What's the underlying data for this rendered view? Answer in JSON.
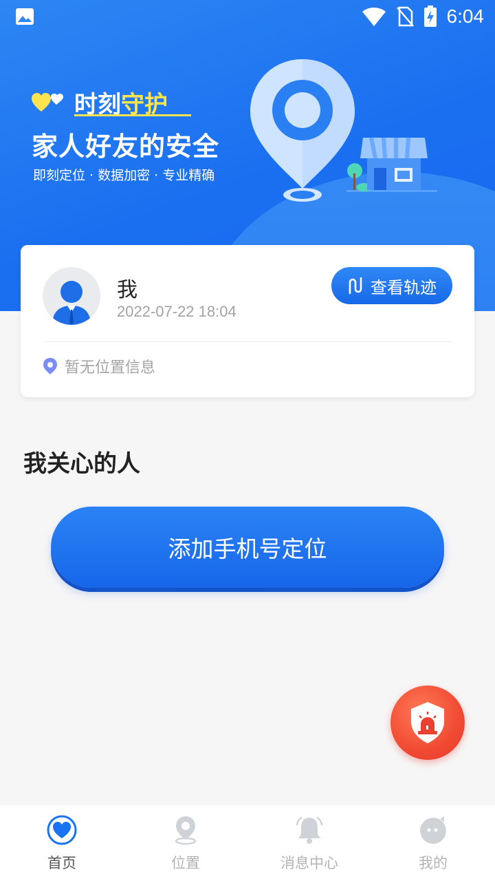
{
  "status_bar": {
    "time": "6:04"
  },
  "hero": {
    "title_part1": "时刻",
    "title_part2": "守护",
    "subtitle": "家人好友的安全",
    "features": "即刻定位 · 数据加密 · 专业精确"
  },
  "my_card": {
    "name": "我",
    "timestamp": "2022-07-22 18:04",
    "track_button": "查看轨迹",
    "location_text": "暂无位置信息"
  },
  "section": {
    "title": "我关心的人"
  },
  "add_button": {
    "label": "添加手机号定位"
  },
  "tabs": [
    {
      "label": "首页",
      "icon": "home-heart-icon",
      "active": true
    },
    {
      "label": "位置",
      "icon": "location-pin-icon",
      "active": false
    },
    {
      "label": "消息中心",
      "icon": "bell-icon",
      "active": false
    },
    {
      "label": "我的",
      "icon": "profile-face-icon",
      "active": false
    }
  ],
  "colors": {
    "primary": "#1a6ff0",
    "accent_yellow": "#ffe44d",
    "sos_red": "#f14a33"
  }
}
